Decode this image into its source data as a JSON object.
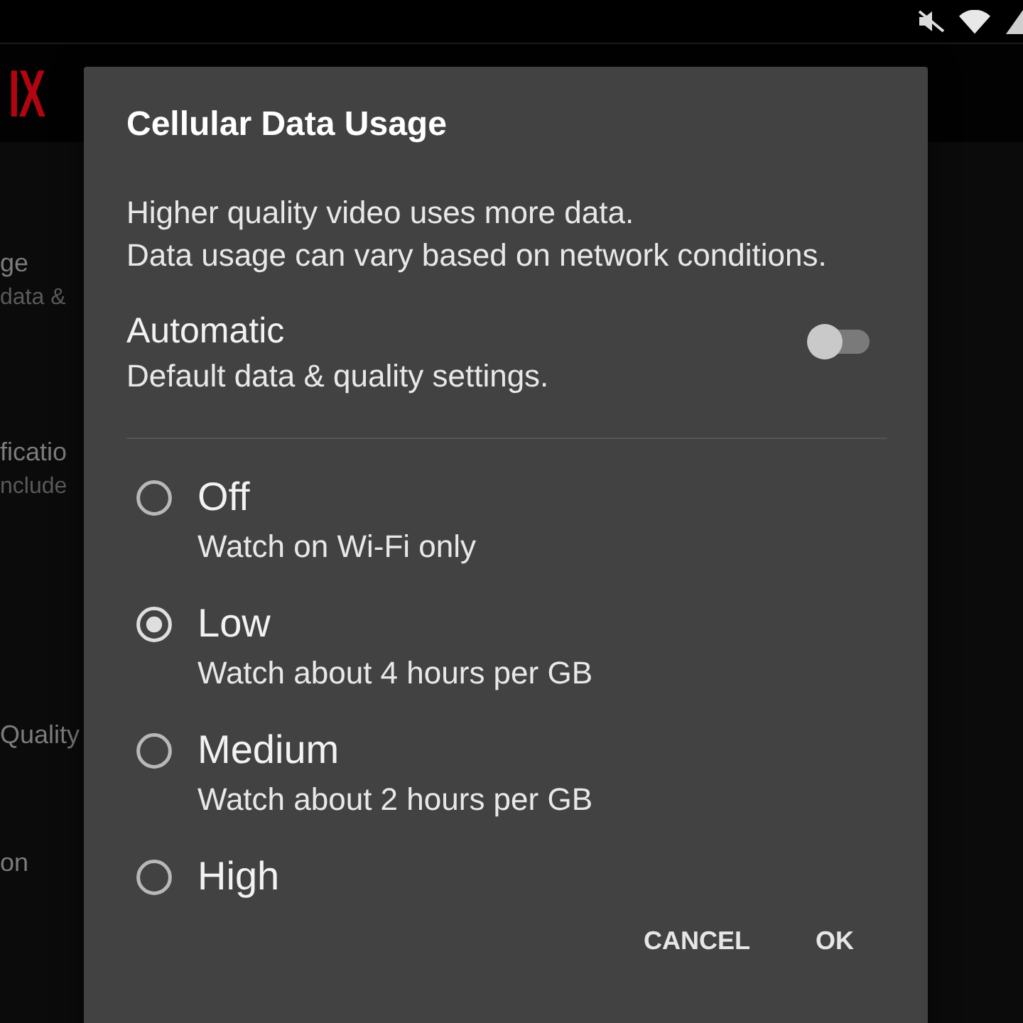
{
  "app": {
    "logo": "IX",
    "settings": [
      {
        "title": "ge",
        "subtitle": "data &"
      },
      {
        "title": "ficatio",
        "subtitle": "nclude"
      },
      {
        "title": "Quality"
      },
      {
        "title": "on"
      }
    ]
  },
  "dialog": {
    "title": "Cellular Data Usage",
    "description": [
      "Higher quality video uses more data.",
      "Data usage can vary based on network conditions."
    ],
    "automatic": {
      "title": "Automatic",
      "subtitle": "Default data & quality settings.",
      "on": false
    },
    "options": [
      {
        "label": "Off",
        "description": "Watch on Wi-Fi only",
        "selected": false
      },
      {
        "label": "Low",
        "description": "Watch about 4 hours per GB",
        "selected": true
      },
      {
        "label": "Medium",
        "description": "Watch about 2 hours per GB",
        "selected": false
      },
      {
        "label": "High",
        "selected": false
      }
    ],
    "buttons": [
      {
        "label": "CANCEL"
      },
      {
        "label": "OK"
      }
    ]
  }
}
